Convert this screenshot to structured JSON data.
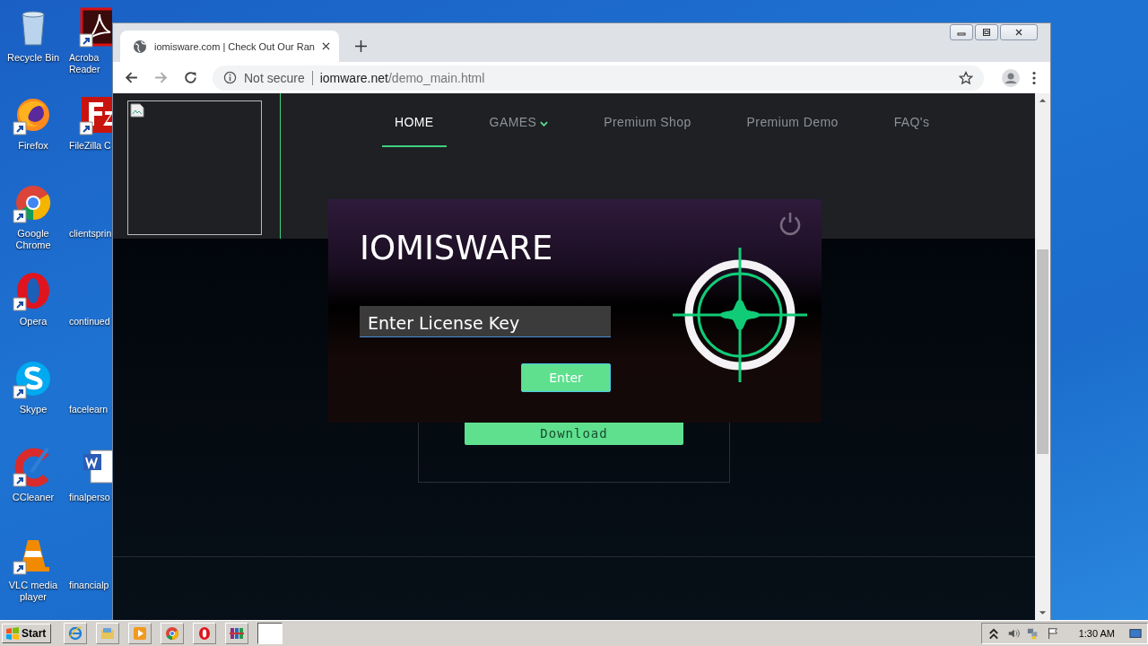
{
  "desktop": {
    "icons": [
      {
        "label": "Recycle Bin",
        "kind": "recycle",
        "shortcut": false
      },
      {
        "label": "Acroba\nReader",
        "kind": "pdf",
        "shortcut": true
      },
      {
        "label": "Firefox",
        "kind": "firefox",
        "shortcut": true
      },
      {
        "label": "FileZilla C",
        "kind": "filezilla",
        "shortcut": true
      },
      {
        "label": "Google\nChrome",
        "kind": "chrome",
        "shortcut": true
      },
      {
        "label": "clientsprin"
      },
      {
        "label": "Opera",
        "kind": "opera",
        "shortcut": true
      },
      {
        "label": "continued"
      },
      {
        "label": "Skype",
        "kind": "skype",
        "shortcut": true
      },
      {
        "label": "facelearn"
      },
      {
        "label": "CCleaner",
        "kind": "ccleaner",
        "shortcut": true
      },
      {
        "label": "finalperso",
        "kind": "word",
        "shortcut": false
      },
      {
        "label": "VLC media\nplayer",
        "kind": "vlc",
        "shortcut": true
      },
      {
        "label": "financialp"
      }
    ]
  },
  "browser": {
    "tab": {
      "title": "iomisware.com | Check Out Our Ran"
    },
    "security": "Not secure",
    "url_host": "iomware.net",
    "url_path": "/demo_main.html"
  },
  "page": {
    "nav": [
      {
        "label": "HOME",
        "selected": true,
        "dropdown": false
      },
      {
        "label": "GAMES",
        "selected": false,
        "dropdown": true
      },
      {
        "label": "Premium Shop",
        "selected": false,
        "dropdown": false
      },
      {
        "label": "Premium Demo",
        "selected": false,
        "dropdown": false
      },
      {
        "label": "FAQ's",
        "selected": false,
        "dropdown": false
      }
    ],
    "download_button": "Download"
  },
  "dialog": {
    "title": "IOMISWARE",
    "license_field": {
      "placeholder": "Enter License Key"
    },
    "enter_button": "Enter"
  },
  "taskbar": {
    "start": "Start",
    "apps": [
      {
        "kind": "ie"
      },
      {
        "kind": "explorer"
      },
      {
        "kind": "media"
      },
      {
        "kind": "chrome"
      },
      {
        "kind": "opera"
      },
      {
        "kind": "winrar"
      },
      {
        "kind": "blank"
      }
    ],
    "clock": "1:30 AM"
  }
}
